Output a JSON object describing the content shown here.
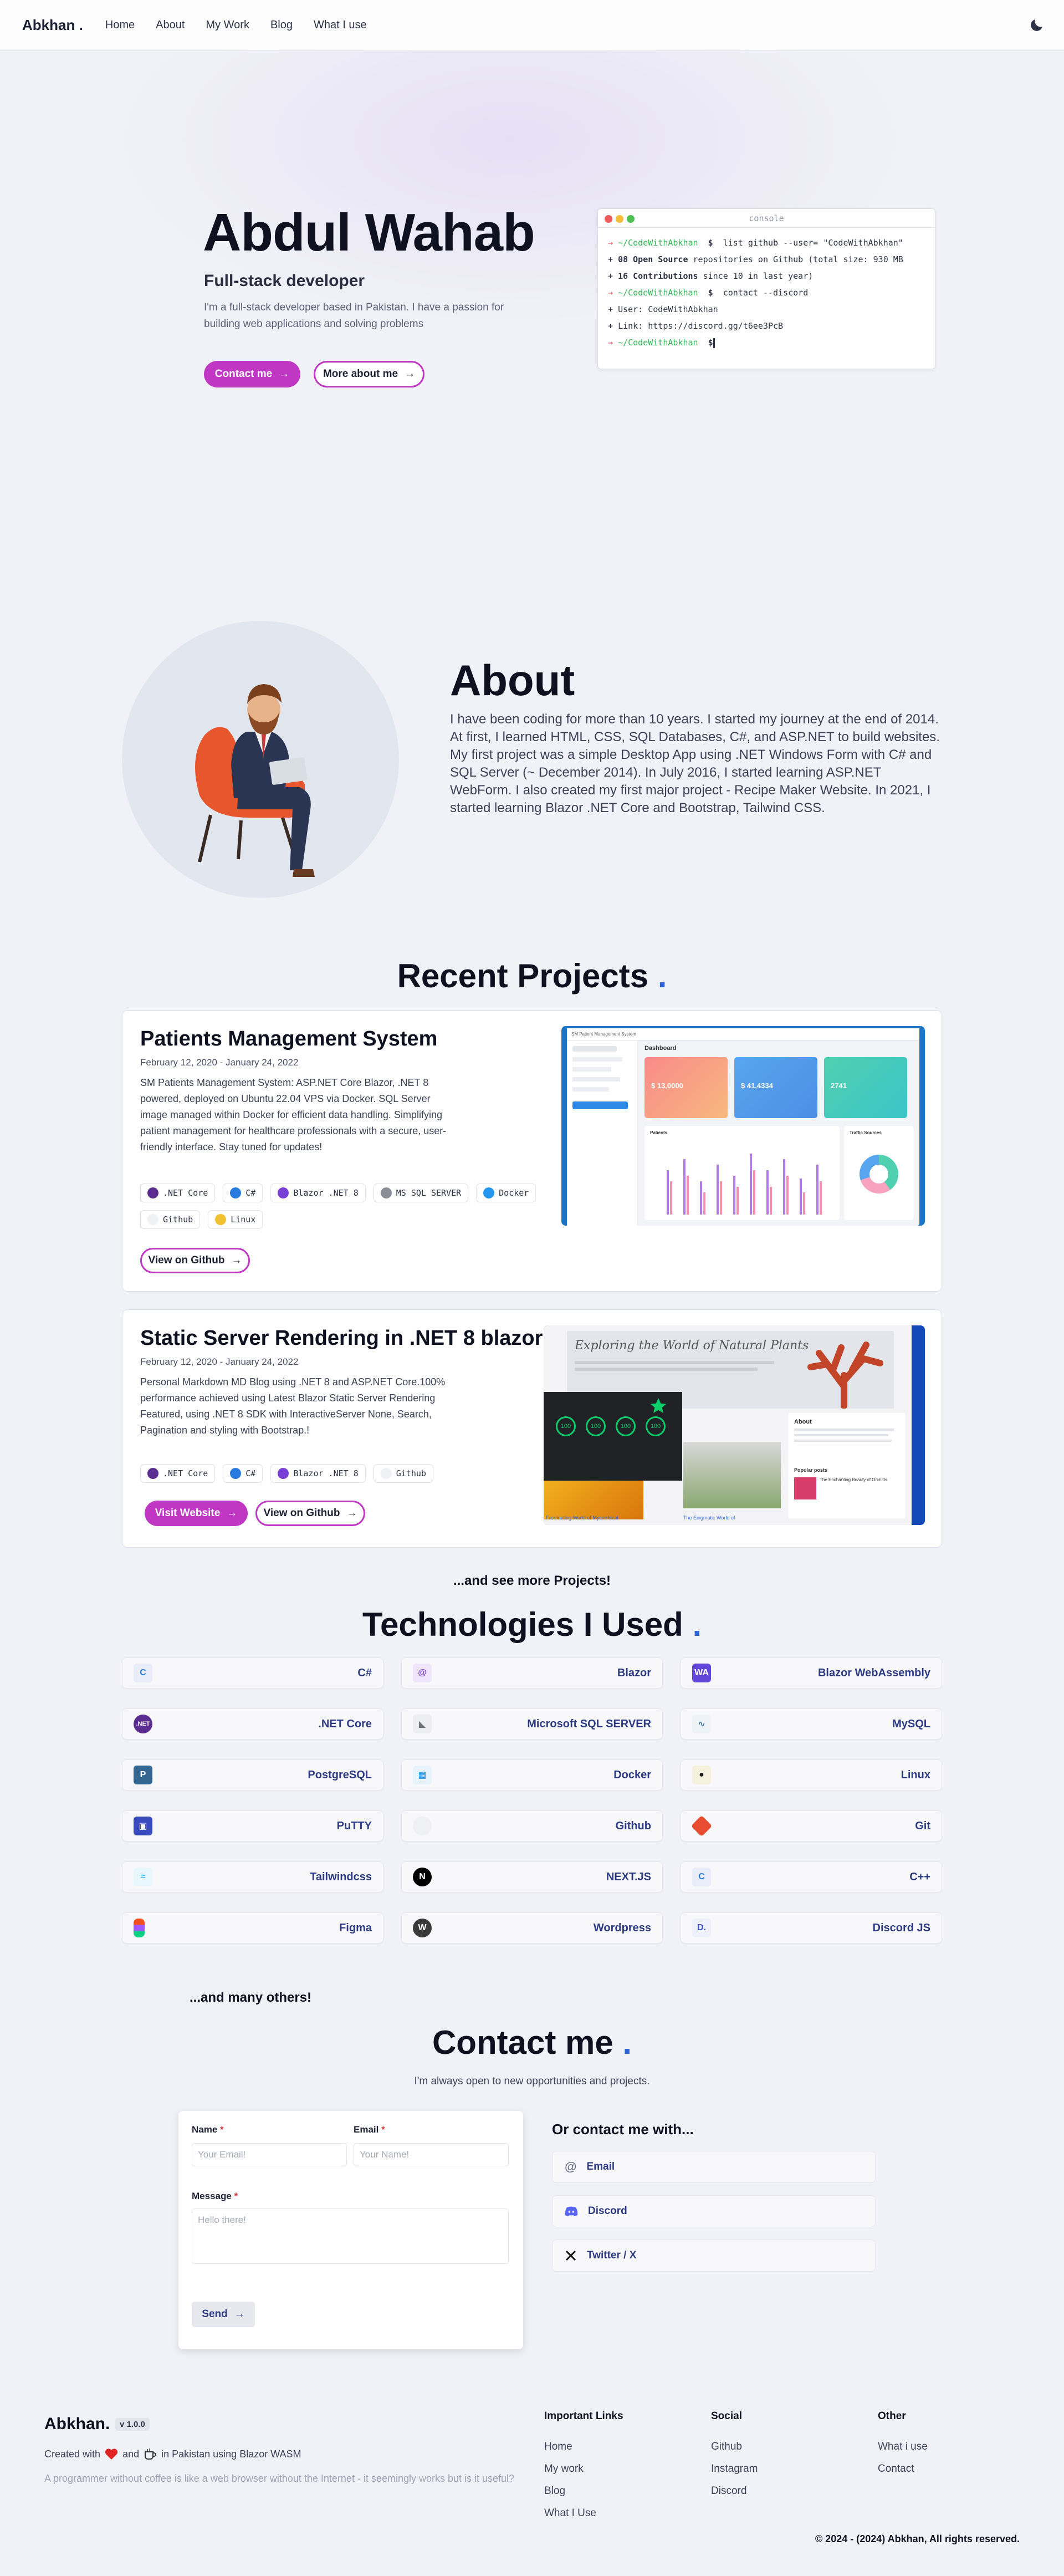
{
  "nav": {
    "brand": "Abkhan .",
    "links": [
      "Home",
      "About",
      "My Work",
      "Blog",
      "What I use"
    ],
    "theme_toggle_icon": "moon-icon"
  },
  "hero": {
    "name": "Abdul Wahab",
    "role": "Full-stack developer",
    "description": "I'm a full-stack developer based in Pakistan. I have a passion for building web applications and solving problems",
    "contact_button": "Contact me",
    "more_button": "More about me"
  },
  "console": {
    "title": "console",
    "prompt": "~/CodeWithAbkhan",
    "cmd1": "list github --user= \"CodeWithAbkhan\"",
    "repos_bold": "08 Open Source",
    "repos_rest": "repositories on Github (total size: 930 MB",
    "contrib_bold": "16 Contributions",
    "contrib_rest": "since 10 in last year)",
    "cmd2": "contact --discord",
    "user_line": "User: CodeWithAbkhan",
    "link_line": "Link: https://discord.gg/t6ee3PcB"
  },
  "about": {
    "title": "About",
    "text": "I have been coding for more than 10 years. I started my journey at the end of 2014. At first, I learned HTML, CSS, SQL Databases, C#, and ASP.NET to build websites. My first project was a simple Desktop App using .NET Windows Form with C# and SQL Server (~ December 2014). In July 2016, I started learning ASP.NET WebForm. I also created my first major project - Recipe Maker Website. In 2021, I started learning Blazor .NET Core and Bootstrap, Tailwind CSS."
  },
  "projects": {
    "title": "Recent Projects",
    "items": [
      {
        "title": "Patients Management System",
        "date": "February 12, 2020 - January 24, 2022",
        "description": "SM Patients Management System: ASP.NET Core Blazor, .NET 8 powered, deployed on Ubuntu 22.04 VPS via Docker. SQL Server image managed within Docker for efficient data handling. Simplifying patient management for healthcare professionals with a secure, user-friendly interface. Stay tuned for updates!",
        "tags": [
          ".NET Core",
          "C#",
          "Blazor .NET 8",
          "MS SQL SERVER",
          "Docker",
          "Github",
          "Linux"
        ],
        "github_button": "View on Github"
      },
      {
        "title": "Static Server Rendering in .NET 8 blazor",
        "date": "February 12, 2020 - January 24, 2022",
        "description": "Personal Markdown MD Blog using .NET 8 and ASP.NET Core.100% performance achieved using Latest Blazor Static Server Rendering Featured, using .NET 8 SDK with InteractiveServer None, Search, Pagination and styling with Bootstrap.!",
        "tags": [
          ".NET Core",
          "C#",
          "Blazor .NET 8",
          "Github"
        ],
        "visit_button": "Visit Website",
        "github_button": "View on Github"
      }
    ],
    "more": "...and see more Projects!"
  },
  "dashboard_shot": {
    "brand": "SM Patient Management System",
    "title": "Dashboard",
    "card1": "$ 13,0000",
    "card2": "$ 41,4334",
    "card3": "2741",
    "panel1": "Patients",
    "panel2": "Traffic Sources"
  },
  "blog_shot": {
    "heading": "Exploring the World of Natural Plants",
    "about": "About",
    "popular": "Popular posts",
    "scores": [
      "100",
      "100",
      "100",
      "100"
    ],
    "post1": "Fascinating World of Mycorrhizal",
    "post2": "The Enigmatic World of",
    "post3": "The Enchanting Beauty of Orchids"
  },
  "technologies": {
    "title": "Technologies I Used",
    "items": [
      {
        "name": "C#",
        "icon": "csharp-icon",
        "color": "#2a7be0"
      },
      {
        "name": "Blazor",
        "icon": "blazor-icon",
        "color": "#7a3fd6"
      },
      {
        "name": "Blazor WebAssembly",
        "icon": "webassembly-icon",
        "color": "#6147d8"
      },
      {
        "name": ".NET Core",
        "icon": "dotnet-icon",
        "color": "#5c2d91"
      },
      {
        "name": "Microsoft SQL SERVER",
        "icon": "sql-server-icon",
        "color": "#707480"
      },
      {
        "name": "MySQL",
        "icon": "mysql-icon",
        "color": "#3c79a8"
      },
      {
        "name": "PostgreSQL",
        "icon": "postgresql-icon",
        "color": "#336791"
      },
      {
        "name": "Docker",
        "icon": "docker-icon",
        "color": "#2496ed"
      },
      {
        "name": "Linux",
        "icon": "linux-icon",
        "color": "#1f1f1f"
      },
      {
        "name": "PuTTY",
        "icon": "putty-icon",
        "color": "#3a4bbd"
      },
      {
        "name": "Github",
        "icon": "github-icon",
        "color": "#e7e8ee"
      },
      {
        "name": "Git",
        "icon": "git-icon",
        "color": "#e84d31"
      },
      {
        "name": "Tailwindcss",
        "icon": "tailwind-icon",
        "color": "#38bdf8"
      },
      {
        "name": "NEXT.JS",
        "icon": "nextjs-icon",
        "color": "#000000"
      },
      {
        "name": "C++",
        "icon": "cpp-icon",
        "color": "#2a7be0"
      },
      {
        "name": "Figma",
        "icon": "figma-icon",
        "color": "#f24e1e"
      },
      {
        "name": "Wordpress",
        "icon": "wordpress-icon",
        "color": "#3a3a3a"
      },
      {
        "name": "Discord JS",
        "icon": "discordjs-icon",
        "color": "#3b55c4"
      }
    ],
    "more": "...and many others!"
  },
  "contact": {
    "title": "Contact me",
    "subtitle": "I'm always open to new opportunities and projects.",
    "name_label": "Name",
    "name_placeholder": "Your Email!",
    "email_label": "Email",
    "email_placeholder": "Your Name!",
    "message_label": "Message",
    "message_placeholder": "Hello there!",
    "send": "Send",
    "or_title": "Or contact me with...",
    "channels": [
      "Email",
      "Discord",
      "Twitter / X"
    ]
  },
  "footer": {
    "brand": "Abkhan.",
    "version": "v 1.0.0",
    "made_1": "Created with",
    "made_2": "and",
    "made_3": "in Pakistan using Blazor WASM",
    "quote": "A programmer without coffee is like a web browser without the Internet - it seemingly works but is it useful?",
    "col1_head": "Important Links",
    "col1_links": [
      "Home",
      "My work",
      "Blog",
      "What I Use"
    ],
    "col2_head": "Social",
    "col2_links": [
      "Github",
      "Instagram",
      "Discord"
    ],
    "col3_head": "Other",
    "col3_links": [
      "What i use",
      "Contact"
    ],
    "copyright": "© 2024 - (2024) Abkhan, All rights reserved."
  },
  "colors": {
    "accent": "#c037c3",
    "link_blue": "#2b3a82",
    "dot_blue": "#2e63d9"
  }
}
